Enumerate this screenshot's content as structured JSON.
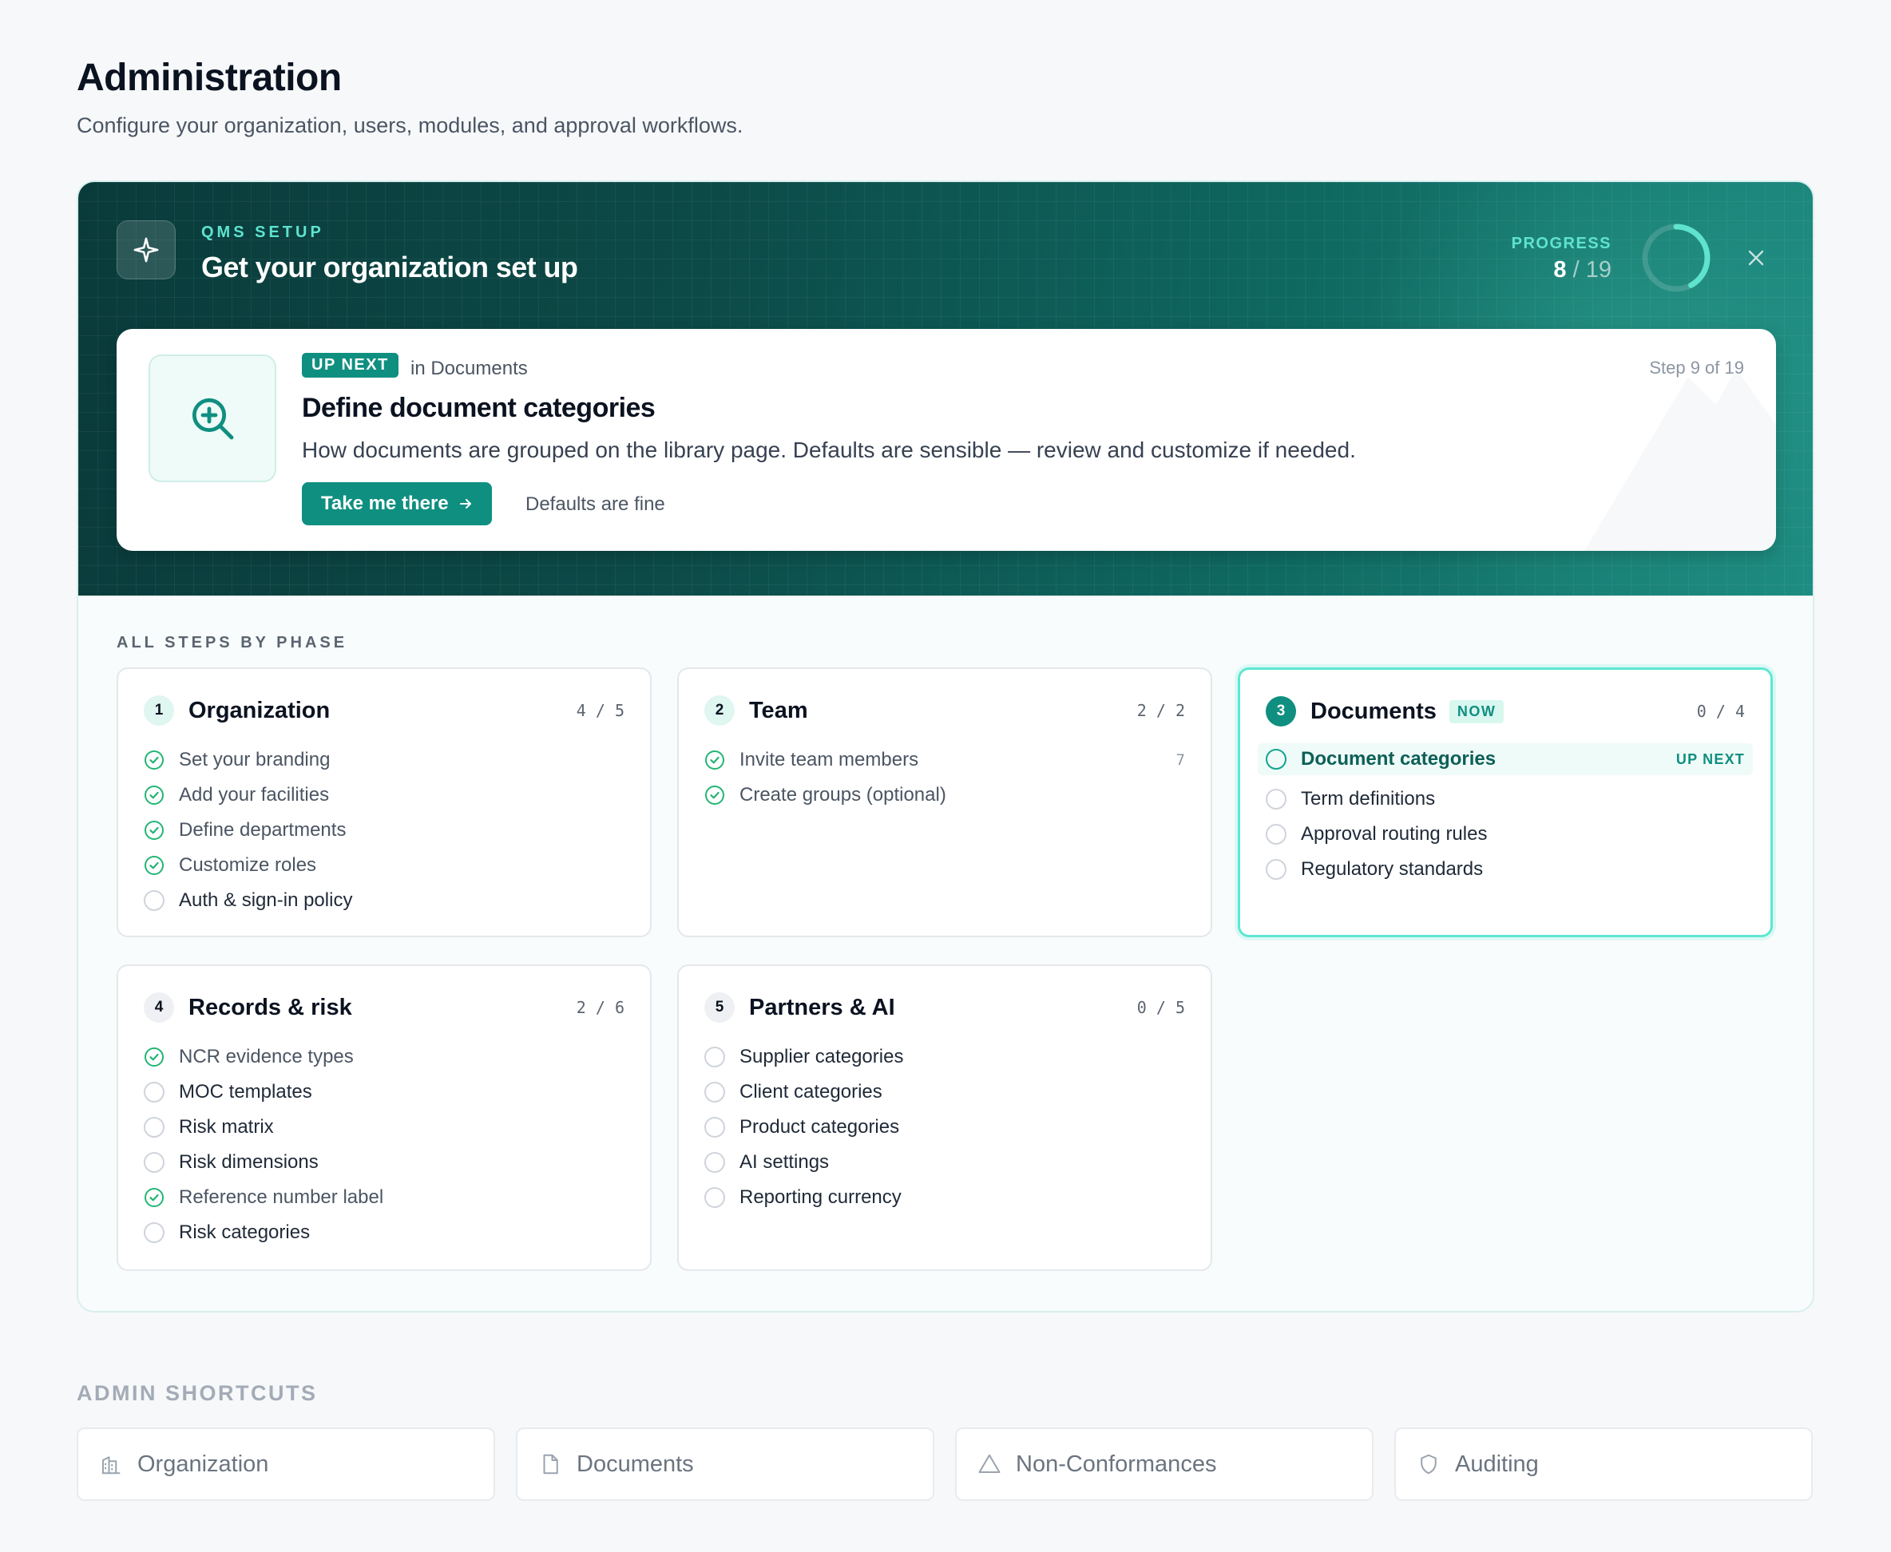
{
  "page": {
    "title": "Administration",
    "subtitle": "Configure your organization, users, modules, and approval workflows."
  },
  "setup": {
    "kicker": "QMS SETUP",
    "title": "Get your organization set up",
    "progress_label": "PROGRESS",
    "progress_done": "8",
    "progress_total": "/ 19",
    "progress_fraction": 0.42,
    "close_icon": "close-icon",
    "accent_color": "#0f8f80",
    "highlight_color": "#5fe3cf"
  },
  "next_step": {
    "badge": "UP NEXT",
    "context": "in Documents",
    "step_of": "Step 9 of 19",
    "title": "Define document categories",
    "description": "How documents are grouped on the library page. Defaults are sensible — review and customize if needed.",
    "primary_label": "Take me there",
    "secondary_label": "Defaults are fine",
    "icon": "zoom-in-icon"
  },
  "phases_label": "ALL STEPS BY PHASE",
  "phases": [
    {
      "num": "1",
      "name": "Organization",
      "count": "4 / 5",
      "steps": [
        {
          "label": "Set your branding",
          "done": true
        },
        {
          "label": "Add your facilities",
          "done": true
        },
        {
          "label": "Define departments",
          "done": true
        },
        {
          "label": "Customize roles",
          "done": true
        },
        {
          "label": "Auth & sign-in policy",
          "done": false
        }
      ]
    },
    {
      "num": "2",
      "name": "Team",
      "count": "2 / 2",
      "steps": [
        {
          "label": "Invite team members",
          "done": true,
          "meta": "7"
        },
        {
          "label": "Create groups (optional)",
          "done": true
        }
      ]
    },
    {
      "num": "3",
      "name": "Documents",
      "count": "0 / 4",
      "badge": "NOW",
      "steps": [
        {
          "label": "Document categories",
          "done": false,
          "meta": "UP NEXT"
        },
        {
          "label": "Term definitions",
          "done": false
        },
        {
          "label": "Approval routing rules",
          "done": false
        },
        {
          "label": "Regulatory standards",
          "done": false
        }
      ]
    },
    {
      "num": "4",
      "name": "Records & risk",
      "count": "2 / 6",
      "steps": [
        {
          "label": "NCR evidence types",
          "done": true
        },
        {
          "label": "MOC templates",
          "done": false
        },
        {
          "label": "Risk matrix",
          "done": false
        },
        {
          "label": "Risk dimensions",
          "done": false
        },
        {
          "label": "Reference number label",
          "done": true
        },
        {
          "label": "Risk categories",
          "done": false
        }
      ]
    },
    {
      "num": "5",
      "name": "Partners & AI",
      "count": "0 / 5",
      "steps": [
        {
          "label": "Supplier categories",
          "done": false
        },
        {
          "label": "Client categories",
          "done": false
        },
        {
          "label": "Product categories",
          "done": false
        },
        {
          "label": "AI settings",
          "done": false
        },
        {
          "label": "Reporting currency",
          "done": false
        }
      ]
    }
  ],
  "shortcuts": {
    "label": "ADMIN SHORTCUTS",
    "items": [
      {
        "label": "Organization",
        "icon": "building-icon"
      },
      {
        "label": "Documents",
        "icon": "document-icon"
      },
      {
        "label": "Non-Conformances",
        "icon": "warning-triangle-icon"
      },
      {
        "label": "Auditing",
        "icon": "shield-icon"
      }
    ]
  }
}
